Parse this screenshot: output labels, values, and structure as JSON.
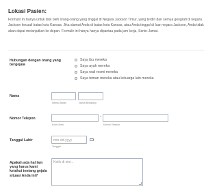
{
  "section": {
    "title": "Lokasi Pasien:",
    "intro": "Formulir ini hanya untuk diisi oleh orang-orang yang tinggal di Negara Jackson Timur, yang terdiri dari semua geografi di negara Jackson kecuali batas kota Kansas. Jika alamat Anda di batas kota Kansas, atau Anda tinggal di luar negara Jackson, Anda tidak akan dapat melanjutkan ke depan. Formulir ini hanya hanya dipantau pada jam kerja, Senin-Jumat."
  },
  "relationship": {
    "label": "Hubungan dengan orang yang bergejala",
    "options": [
      "Saya ibu mereka",
      "Saya ayah mereka",
      "Saya wali resmi mereka",
      "Saya teman mereka atau keluarga lain mereka"
    ]
  },
  "name": {
    "label": "Nama",
    "first_sublabel": "Nama Depan",
    "last_sublabel": "Nama Belakang"
  },
  "phone": {
    "label": "Nomor Telepon",
    "separator": "-",
    "area_sublabel": "Kode Area",
    "number_sublabel": "Nomor Telepon"
  },
  "dob": {
    "label": "Tanggal Lahir",
    "placeholder": "mm-dd-yyyy",
    "sublabel": "Tanggal",
    "icon": "calendar-icon"
  },
  "notes": {
    "label": "Apakah ada hal lain yang harus kami ketahui tentang gejala situasi Anda ini?",
    "placeholder": "Ketik di sini..."
  }
}
